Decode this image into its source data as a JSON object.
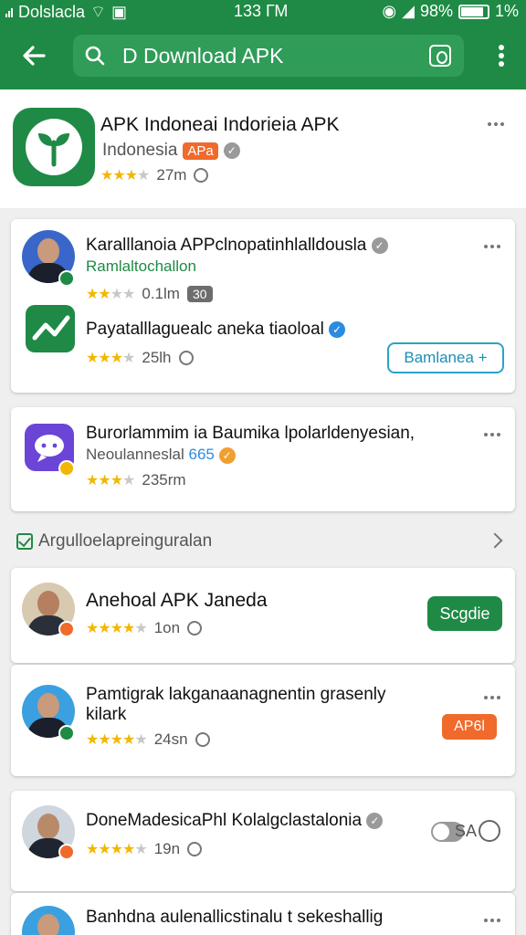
{
  "status_bar": {
    "carrier": "Dolslacla",
    "time": "133 ГМ",
    "battery_percent": "98%",
    "extra": "1%"
  },
  "app_bar": {
    "search_text": "D Download APK",
    "icons": [
      "back-arrow-icon",
      "search-icon",
      "camera-icon",
      "more-vert-icon"
    ]
  },
  "featured": {
    "title": "APK Indoneai Indorieia APK",
    "subtitle": "Indonesia",
    "badge": "APa",
    "meta": "27m"
  },
  "card1": {
    "item1": {
      "title": "Karalllanoia APPclnopatinhlalldousla",
      "subtitle": "Ramlaltochallon",
      "meta": "0.1lm",
      "pill": "30"
    },
    "item2": {
      "title": "Payatalllaguealc aneka tiaoloal",
      "meta": "25lh",
      "button": "Bamlanea"
    }
  },
  "card2": {
    "title": "Burorlammim ia Baumika lpolarldenyesian,",
    "subtitle": "Neoulanneslal",
    "subtitle_num": "665",
    "meta": "235rm"
  },
  "section": {
    "title": "Argulloelapreinguralan"
  },
  "card3": {
    "title": "Anehoal APK Janeda",
    "meta": "1on",
    "button": "Scgdie"
  },
  "card4": {
    "title_line1": "Pamtigrak lakganaanagnentin grasenly",
    "title_line2": "kilark",
    "meta": "24sn",
    "button": "AP6l"
  },
  "card5": {
    "title": "DoneMadesicaPhl Kolalgclastalonia",
    "meta": "19n",
    "toggle_label": "SA"
  },
  "card6": {
    "title": "Banhdna aulenallicstinalu t sekeshallig"
  },
  "colors": {
    "primary_green": "#1f8a45",
    "accent_orange": "#f06a2c",
    "link_blue": "#2aa4c8",
    "star_yellow": "#f2b705"
  }
}
